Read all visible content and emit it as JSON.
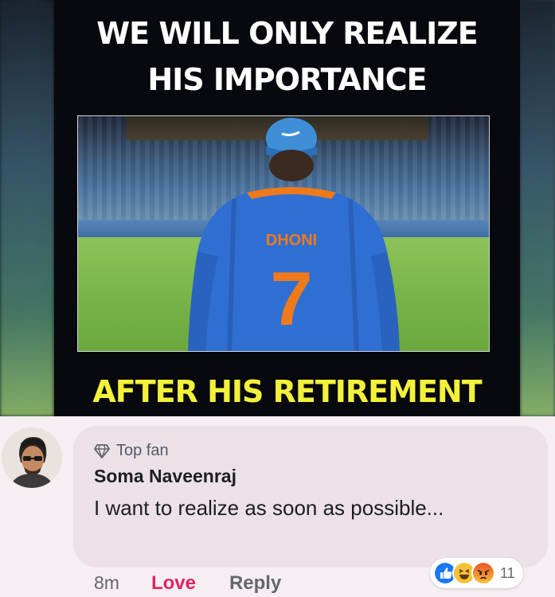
{
  "meme": {
    "top_line_1": "WE WILL ONLY REALIZE",
    "top_line_2": "HIS IMPORTANCE",
    "bottom_line": "AFTER HIS RETIREMENT",
    "jersey_name": "DHONI",
    "jersey_number": "7",
    "colors": {
      "top_text": "#ffffff",
      "bottom_text": "#f3f23a",
      "jersey": "#2f6fd1",
      "number": "#f07a1a"
    }
  },
  "comment": {
    "badge": {
      "icon": "diamond-icon",
      "label": "Top fan"
    },
    "author": "Soma Naveenraj",
    "text": "I want to realize as soon as possible...",
    "time": "8m",
    "love_label": "Love",
    "reply_label": "Reply",
    "reactions": {
      "icons": [
        "like-icon",
        "haha-icon",
        "angry-icon"
      ],
      "count": "11"
    }
  }
}
